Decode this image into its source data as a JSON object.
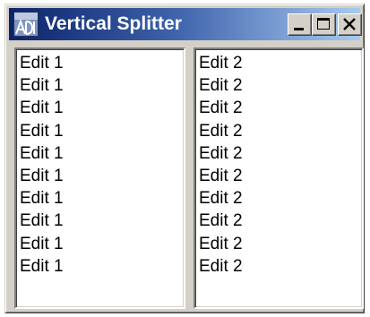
{
  "window": {
    "title": "Vertical Splitter",
    "icon": "app-icon",
    "controls": {
      "minimize": "minimize-icon",
      "maximize": "maximize-icon",
      "close": "close-icon"
    }
  },
  "left_edit": {
    "lines": [
      "Edit 1",
      "Edit 1",
      "Edit 1",
      "Edit 1",
      "Edit 1",
      "Edit 1",
      "Edit 1",
      "Edit 1",
      "Edit 1",
      "Edit 1"
    ]
  },
  "right_edit": {
    "lines": [
      "Edit 2",
      "Edit 2",
      "Edit 2",
      "Edit 2",
      "Edit 2",
      "Edit 2",
      "Edit 2",
      "Edit 2",
      "Edit 2",
      "Edit 2"
    ]
  },
  "colors": {
    "titlebar_start": "#0a246a",
    "titlebar_end": "#a6caf0",
    "face": "#d4d0c8"
  }
}
